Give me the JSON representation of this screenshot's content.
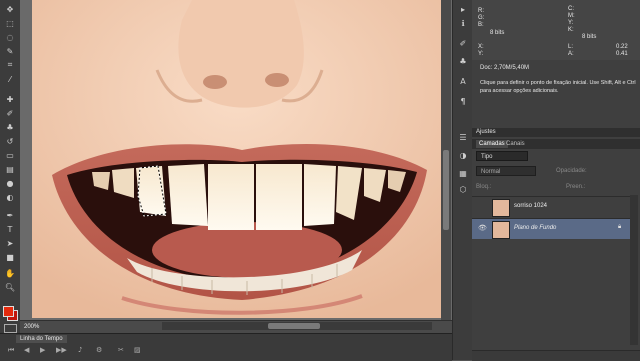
{
  "toolbar": {
    "tools": [
      "move-icon",
      "marquee-icon",
      "lasso-icon",
      "quick-selection-icon",
      "crop-icon",
      "eyedropper-icon",
      "healing-brush-icon",
      "brush-icon",
      "clone-stamp-icon",
      "history-brush-icon",
      "eraser-icon",
      "gradient-icon",
      "blur-icon",
      "dodge-icon",
      "pen-icon",
      "type-icon",
      "path-selection-icon",
      "shape-icon",
      "hand-icon",
      "zoom-icon"
    ],
    "foreground_color": "#e52a0d",
    "background_color": "#c0150b"
  },
  "status": {
    "zoom": "200%"
  },
  "timeline": {
    "tab_label": "Linha do Tempo"
  },
  "info": {
    "r": "R:",
    "g": "G:",
    "b": "B:",
    "c": "C:",
    "m": "M:",
    "y": "Y:",
    "k": "K:",
    "bits_left": "8 bits",
    "bits_right": "8 bits",
    "x": "X:",
    "y_coord": "Y:",
    "x_val": "0.22",
    "y_val": "0.41",
    "w": "L:",
    "h": "A:",
    "doc": "Doc: 2,70M/5,40M",
    "hint": "Clique para definir o ponto de fixação inicial. Use Shift, Alt e Ctrl para acessar opções adicionais."
  },
  "panels": {
    "adjustments_tab": "Ajustes",
    "layers_tab": "Camadas",
    "channels_tab": "Canais",
    "filter_label": "Tipo",
    "blend_mode": "Normal",
    "opacity_label": "Opacidade:",
    "lock_label": "Bloq.:",
    "fill_label": "Preen.:"
  },
  "layers": [
    {
      "name": "sorriso 1024",
      "visible": false,
      "selected": false,
      "locked": false
    },
    {
      "name": "Plano de Fundo",
      "visible": true,
      "selected": true,
      "locked": true
    }
  ],
  "colors": {
    "panel_bg": "#3f3f3f",
    "selected_layer": "#5a6a87",
    "canvas_skin": "#f3cfb6"
  }
}
